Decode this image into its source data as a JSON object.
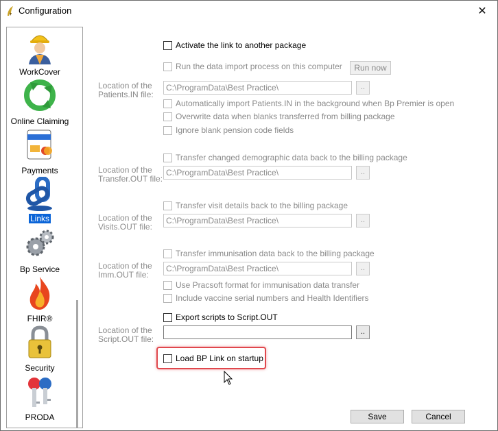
{
  "window": {
    "title": "Configuration",
    "close_glyph": "✕",
    "icon": "wing-logo-icon"
  },
  "sidebar": {
    "selected": "Links",
    "items": [
      {
        "label": "WorkCover",
        "icon": "worker-icon"
      },
      {
        "label": "Online Claiming",
        "icon": "recycle-arrows-icon"
      },
      {
        "label": "Payments",
        "icon": "credit-card-icon"
      },
      {
        "label": "Links",
        "icon": "chain-link-icon"
      },
      {
        "label": "Bp Service",
        "icon": "gears-icon"
      },
      {
        "label": "FHIR®",
        "icon": "flame-icon"
      },
      {
        "label": "Security",
        "icon": "padlock-icon"
      },
      {
        "label": "PRODA",
        "icon": "keys-icon"
      }
    ]
  },
  "form": {
    "activate_link": {
      "label": "Activate the link to another package",
      "checked": false
    },
    "run_import": {
      "label": "Run the data import process on this computer",
      "checked": false
    },
    "run_now_label": "Run now",
    "patients_in": {
      "label_line1": "Location of the",
      "label_line2": "Patients.IN file:",
      "value": "C:\\ProgramData\\Best Practice\\"
    },
    "auto_import": {
      "label": "Automatically import Patients.IN in the background when Bp Premier is open",
      "checked": false
    },
    "overwrite_blanks": {
      "label": "Overwrite data when blanks transferred from billing package",
      "checked": false
    },
    "ignore_pension": {
      "label": "Ignore blank pension code fields",
      "checked": false
    },
    "transfer_demo": {
      "label": "Transfer changed demographic data back to the billing package",
      "checked": false
    },
    "transfer_out": {
      "label_line1": "Location of the",
      "label_line2": "Transfer.OUT file:",
      "value": "C:\\ProgramData\\Best Practice\\"
    },
    "transfer_visit": {
      "label": "Transfer visit details back to the billing package",
      "checked": false
    },
    "visits_out": {
      "label_line1": "Location of the",
      "label_line2": "Visits.OUT file:",
      "value": "C:\\ProgramData\\Best Practice\\"
    },
    "transfer_imm": {
      "label": "Transfer immunisation data back to the billing package",
      "checked": false
    },
    "imm_out": {
      "label_line1": "Location of the",
      "label_line2": "Imm.OUT file:",
      "value": "C:\\ProgramData\\Best Practice\\"
    },
    "pracsoft": {
      "label": "Use Pracsoft format for immunisation data transfer",
      "checked": false
    },
    "vaccine_serial": {
      "label": "Include vaccine serial numbers and Health Identifiers",
      "checked": false
    },
    "export_scripts": {
      "label": "Export scripts to Script.OUT",
      "checked": false
    },
    "script_out": {
      "label_line1": "Location of the",
      "label_line2": "Script.OUT file:",
      "value": ""
    },
    "load_bp_link": {
      "label": "Load BP Link on startup",
      "checked": false
    },
    "browse_label": ".."
  },
  "buttons": {
    "save": "Save",
    "cancel": "Cancel"
  },
  "colors": {
    "selection": "#0a64d8",
    "highlight": "#e0474c"
  }
}
